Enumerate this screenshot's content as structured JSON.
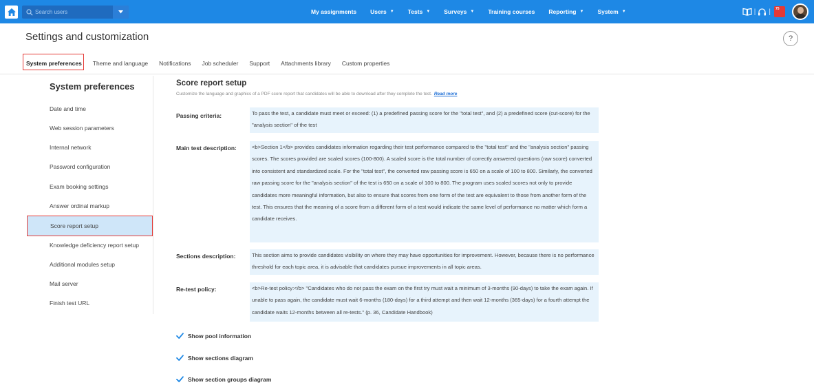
{
  "topbar": {
    "search_placeholder": "Search users",
    "nav": [
      {
        "label": "My assignments",
        "dropdown": false
      },
      {
        "label": "Users",
        "dropdown": true
      },
      {
        "label": "Tests",
        "dropdown": true
      },
      {
        "label": "Surveys",
        "dropdown": true
      },
      {
        "label": "Training courses",
        "dropdown": false
      },
      {
        "label": "Reporting",
        "dropdown": true
      },
      {
        "label": "System",
        "dropdown": true
      }
    ],
    "notification_count": "75",
    "accent_color": "#1e88e5"
  },
  "header": {
    "title": "Settings and customization",
    "help_label": "?"
  },
  "tabs": [
    {
      "label": "System preferences",
      "active": true
    },
    {
      "label": "Theme and language"
    },
    {
      "label": "Notifications"
    },
    {
      "label": "Job scheduler"
    },
    {
      "label": "Support"
    },
    {
      "label": "Attachments library"
    },
    {
      "label": "Custom properties"
    }
  ],
  "sidebar": {
    "title": "System preferences",
    "items": [
      {
        "label": "Date and time"
      },
      {
        "label": "Web session parameters"
      },
      {
        "label": "Internal network"
      },
      {
        "label": "Password configuration"
      },
      {
        "label": "Exam booking settings"
      },
      {
        "label": "Answer ordinal markup"
      },
      {
        "label": "Score report setup",
        "active": true
      },
      {
        "label": "Knowledge deficiency report setup"
      },
      {
        "label": "Additional modules setup"
      },
      {
        "label": "Mail server"
      },
      {
        "label": "Finish test URL"
      }
    ]
  },
  "main": {
    "title": "Score report setup",
    "description": "Customize the language and graphics of a PDF score report that candidates will be able to download after they complete the test.",
    "read_more": "Read more",
    "fields": [
      {
        "label": "Passing criteria:",
        "value": "To pass the test, a candidate must meet or exceed: (1) a predefined passing score for the \"total test\", and (2) a predefined score (cut-score) for the \"analysis section\" of the test"
      },
      {
        "label": "Main test description:",
        "value": "<b>Section 1</b> provides candidates information regarding their test performance compared to the \"total test\" and the \"analysis section\" passing scores. The scores provided are scaled scores (100-800). A scaled score is the total number of correctly answered questions (raw score) converted into consistent and standardized scale. For the \"total test\", the converted raw passing score is 650 on a scale of 100 to 800. Similarly, the converted raw passing score for the \"analysis section\" of the test is 650 on a scale of 100 to 800. The program uses scaled scores not only to provide candidates more meaningful information, but also to ensure that scores from one form of the test are equivalent to those from another form of the test. This ensures that the meaning of a score from a different form of a test would indicate the same level of performance no matter which form a candidate receives."
      },
      {
        "label": "Sections description:",
        "value": "This section aims to provide candidates visibility on where they may have opportunities for improvement. However, because there is no performance threshold for each topic area, it is advisable that candidates pursue improvements in all topic areas."
      },
      {
        "label": "Re-test policy:",
        "value": "<b>Re-test policy:</b> \"Candidates who do not pass the exam on the first try must wait a minimum of 3-months (90-days) to take the exam again. If unable to pass again, the candidate must wait 6-months (180-days) for a third attempt and then wait 12-months (365-days) for a fourth attempt the candidate waits 12-months between all re-tests.\" (p. 36, Candidate Handbook)"
      }
    ],
    "checkboxes": [
      {
        "label": "Show pool information",
        "checked": true
      },
      {
        "label": "Show sections diagram",
        "checked": true
      },
      {
        "label": "Show section groups diagram",
        "checked": true
      }
    ]
  }
}
